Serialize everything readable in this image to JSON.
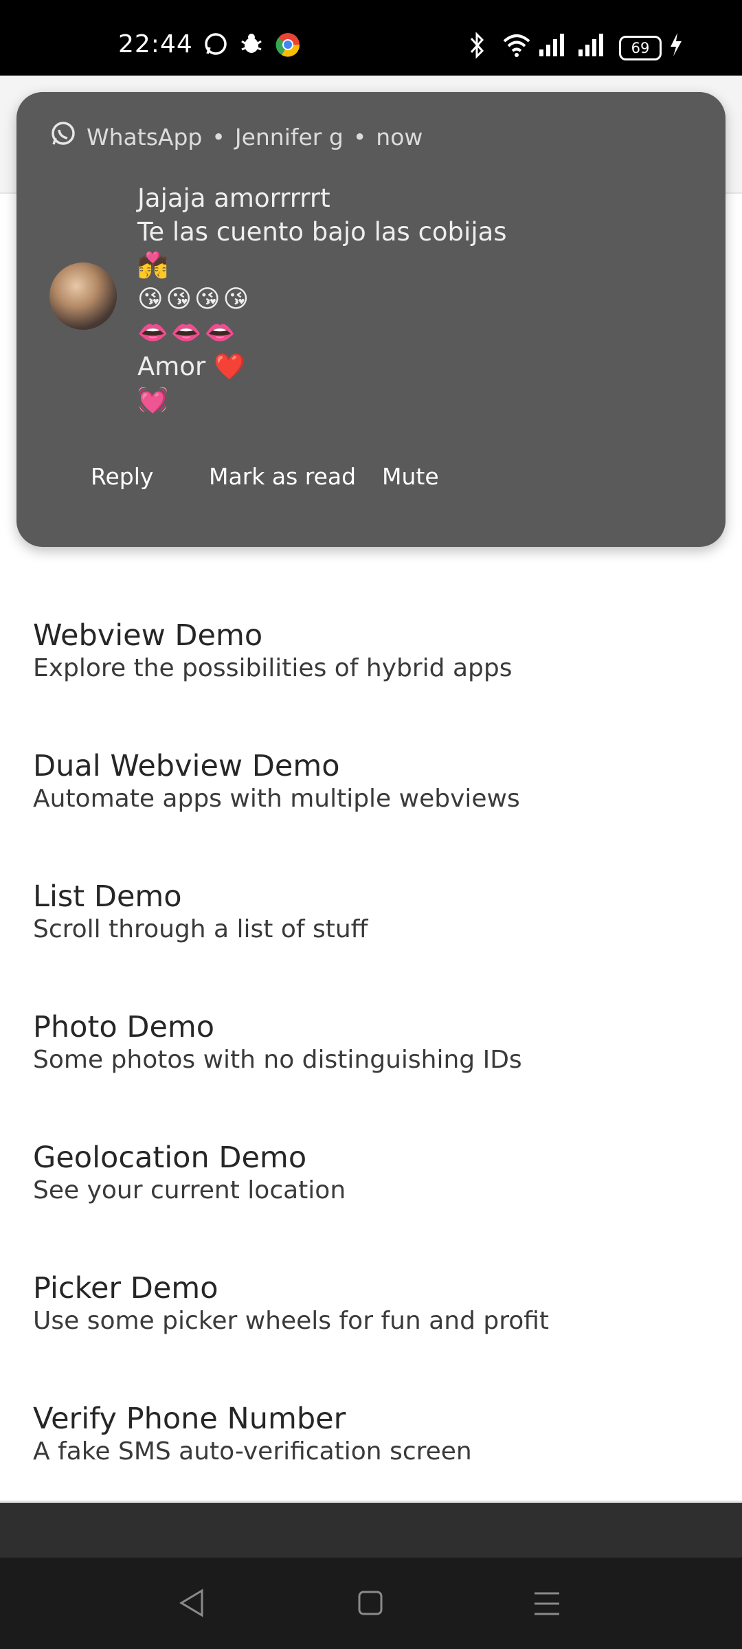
{
  "status_bar": {
    "time": "22:44",
    "battery": "69",
    "icons": [
      "whatsapp-icon",
      "bug-icon",
      "chrome-icon",
      "bluetooth-icon",
      "wifi-icon",
      "signal-icon",
      "signal-icon",
      "battery-icon",
      "charging-icon"
    ]
  },
  "notification": {
    "app_name": "WhatsApp",
    "sender": "Jennifer g",
    "time": "now",
    "messages": [
      {
        "text": "Jajaja amorrrrrt"
      },
      {
        "text": "Te las cuento bajo las cobijas"
      },
      {
        "text": "💏"
      },
      {
        "text": "😘😘😘😘"
      },
      {
        "text": "👄👄👄"
      },
      {
        "text": "Amor ❤️"
      },
      {
        "text": "💓"
      }
    ],
    "actions": {
      "reply": "Reply",
      "mark_as_read": "Mark as read",
      "mute": "Mute"
    }
  },
  "list": [
    {
      "title": "Webview Demo",
      "subtitle": "Explore the possibilities of hybrid apps"
    },
    {
      "title": "Dual Webview Demo",
      "subtitle": "Automate apps with multiple webviews"
    },
    {
      "title": "List Demo",
      "subtitle": "Scroll through a list of stuff"
    },
    {
      "title": "Photo Demo",
      "subtitle": "Some photos with no distinguishing IDs"
    },
    {
      "title": "Geolocation Demo",
      "subtitle": "See your current location"
    },
    {
      "title": "Picker Demo",
      "subtitle": "Use some picker wheels for fun and profit"
    },
    {
      "title": "Verify Phone Number",
      "subtitle": "A fake SMS auto-verification screen"
    }
  ],
  "nav_bar": {
    "icons": [
      "back-icon",
      "home-icon",
      "menu-icon"
    ]
  }
}
